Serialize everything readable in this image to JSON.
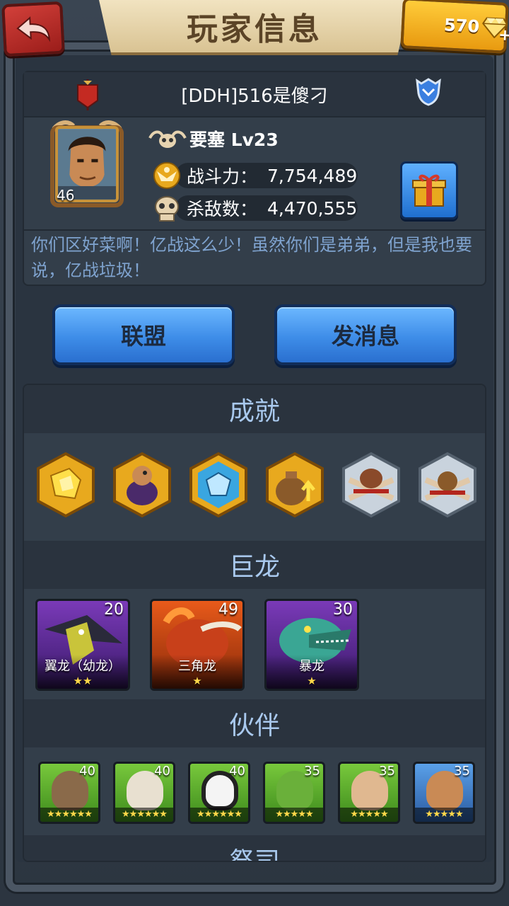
{
  "header": {
    "title": "玩家信息",
    "gems": "570",
    "gem_plus": "+"
  },
  "player": {
    "name": "[DDH]516是傻刁",
    "avatar_level": "46",
    "fortress_label": "要塞 Lv23",
    "power_label": "战斗力：",
    "power_value": "7,754,489",
    "kills_label": "杀敌数：",
    "kills_value": "4,470,555",
    "motto": "你们区好菜啊！亿战这么少！虽然你们是弟弟，但是我也要说，亿战垃圾！"
  },
  "buttons": {
    "alliance": "联盟",
    "message": "发消息"
  },
  "sections": {
    "achievements": {
      "title": "成就",
      "badges": [
        "gold-crystal-badge",
        "gold-egg-badge",
        "gold-ice-dragon-badge",
        "gold-bag-badge",
        "silver-skull-badge",
        "silver-bag-badge"
      ]
    },
    "dragons": {
      "title": "巨龙",
      "items": [
        {
          "name": "翼龙（幼龙）",
          "level": "20",
          "stars": "★★"
        },
        {
          "name": "三角龙",
          "level": "49",
          "stars": "★"
        },
        {
          "name": "暴龙",
          "level": "30",
          "stars": "★"
        }
      ]
    },
    "partners": {
      "title": "伙伴",
      "items": [
        {
          "level": "40",
          "stars": "★★★★★★"
        },
        {
          "level": "40",
          "stars": "★★★★★★"
        },
        {
          "level": "40",
          "stars": "★★★★★★"
        },
        {
          "level": "35",
          "stars": "★★★★★"
        },
        {
          "level": "35",
          "stars": "★★★★★"
        },
        {
          "level": "35",
          "stars": "★★★★★"
        }
      ]
    },
    "priests": {
      "title": "祭司"
    }
  },
  "colors": {
    "panel": "#333e4a",
    "section_title": "#a9c9ee",
    "motto": "#7fa3cf",
    "button_blue": "#3e8de8",
    "gold": "#e8a91e"
  }
}
